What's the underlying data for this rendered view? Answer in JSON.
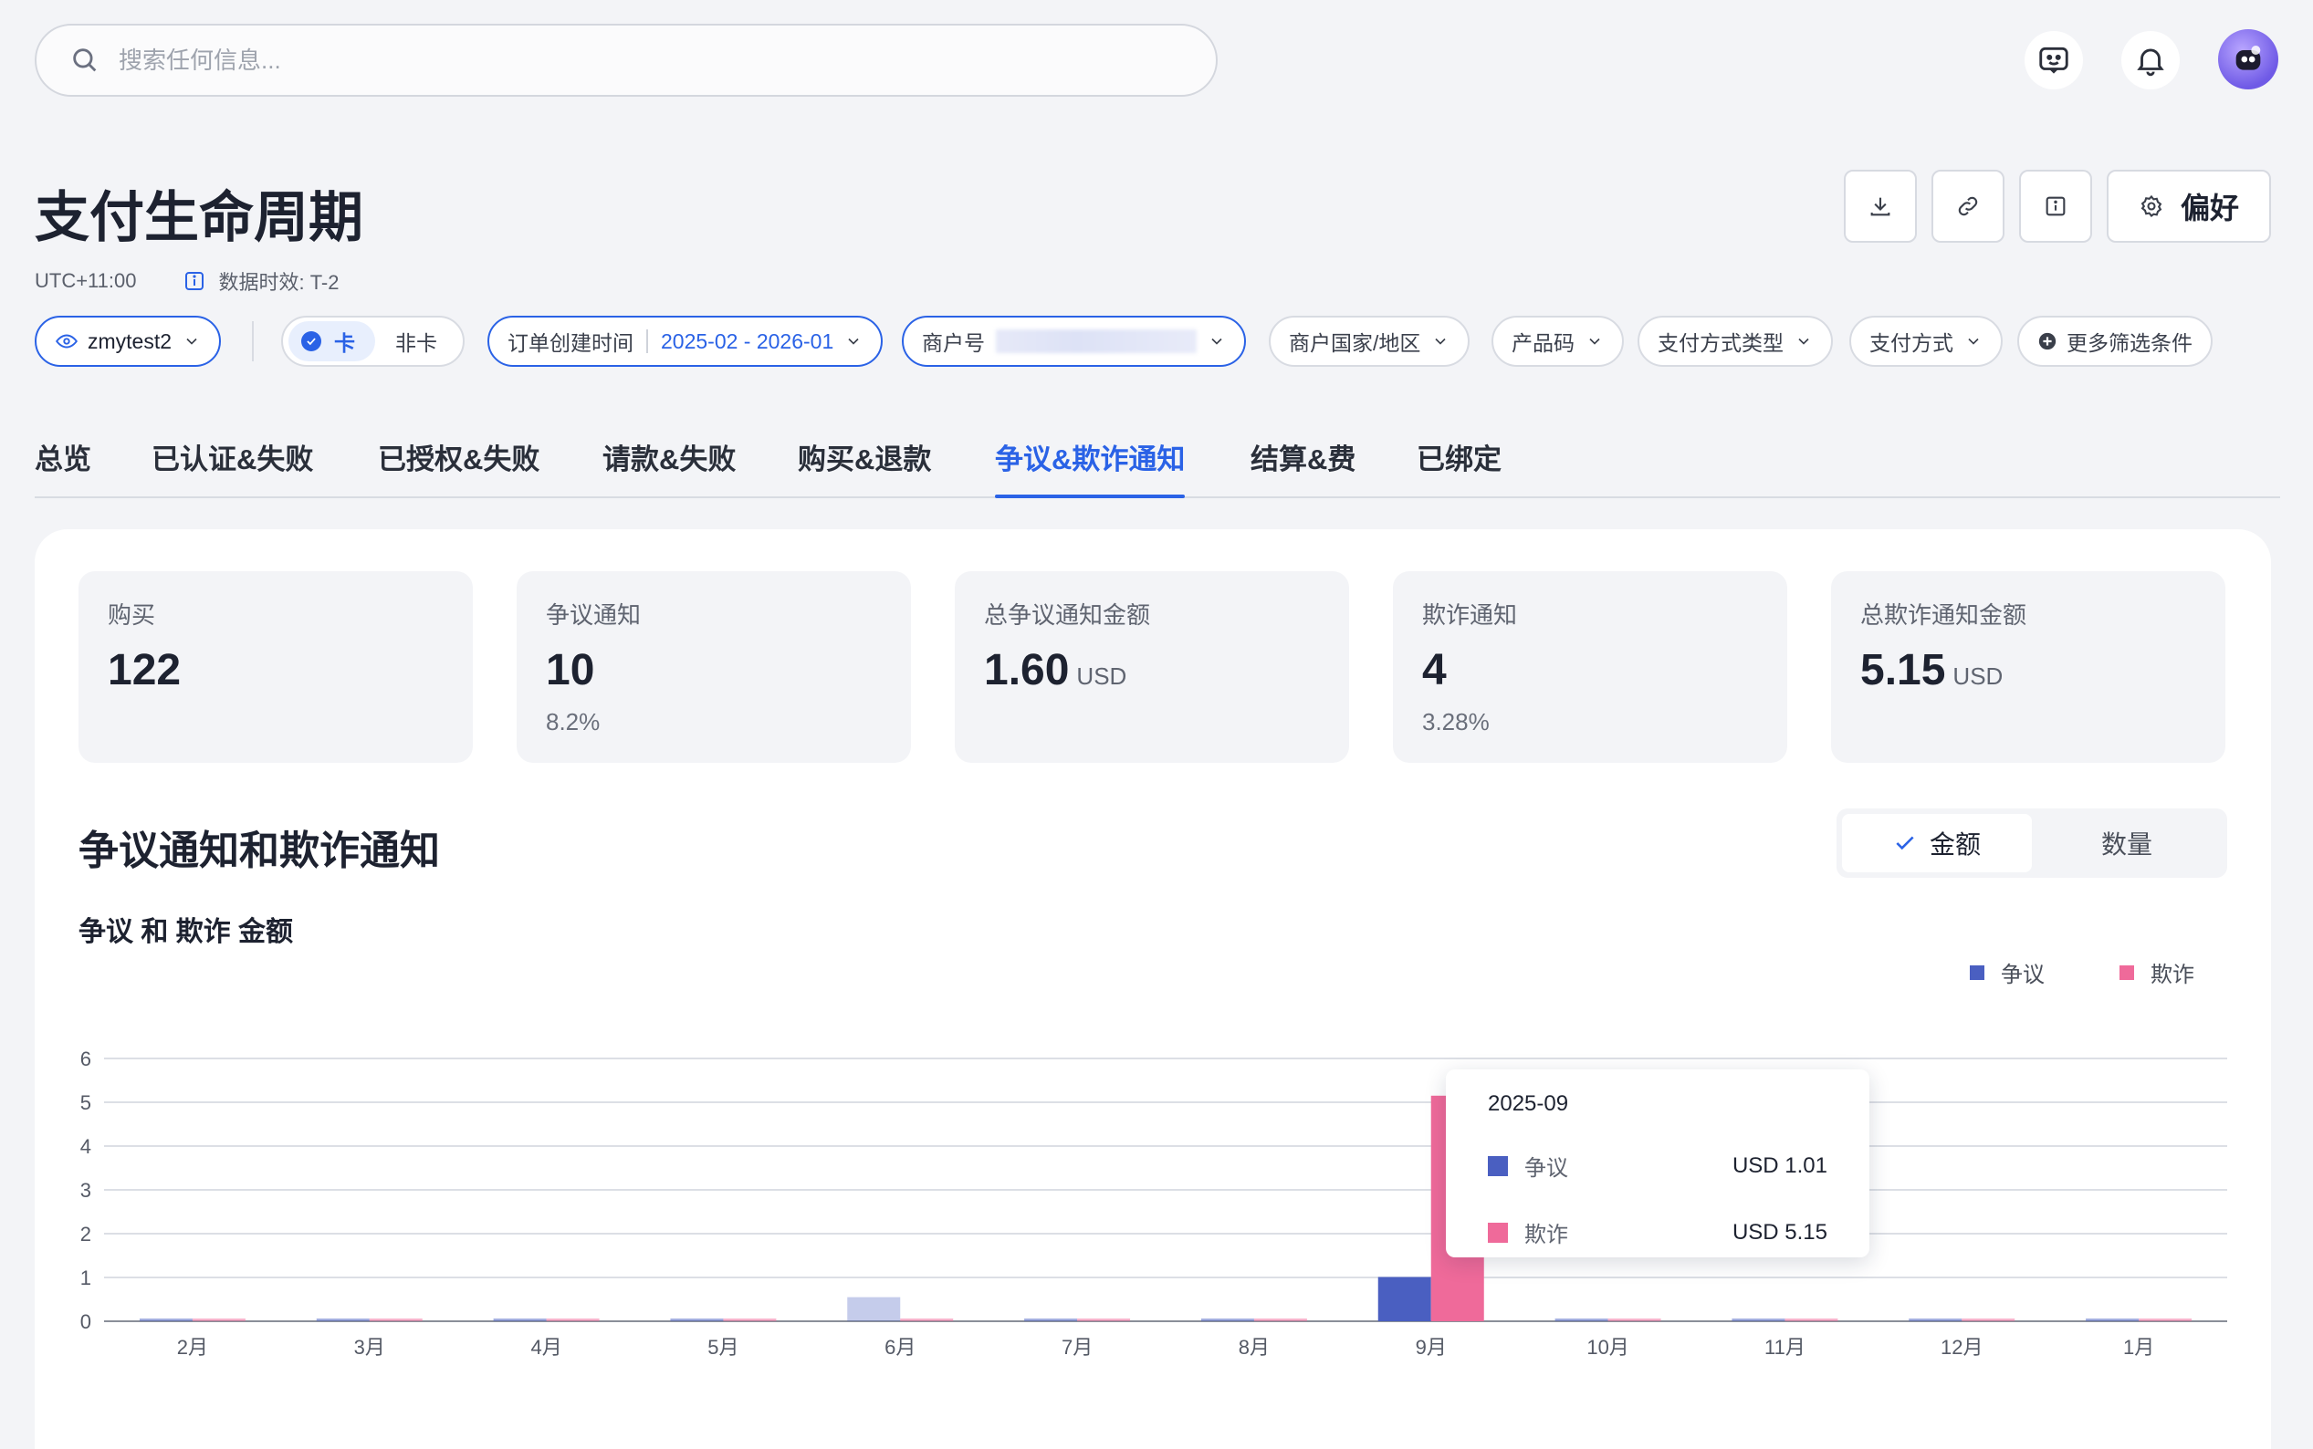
{
  "search": {
    "placeholder": "搜索任何信息..."
  },
  "page": {
    "title": "支付生命周期",
    "timezone": "UTC+11:00",
    "data_freshness": "数据时效: T-2",
    "pref_label": "偏好"
  },
  "filters": {
    "merchant_account": "zmytest2",
    "card": "卡",
    "non_card": "非卡",
    "order_time_label": "订单创建时间",
    "order_time_value": "2025-02 - 2026-01",
    "merchant_id_label": "商户号",
    "merchant_region": "商户国家/地区",
    "product_code": "产品码",
    "payment_method_type": "支付方式类型",
    "payment_method": "支付方式",
    "more_filters": "更多筛选条件"
  },
  "tabs": [
    "总览",
    "已认证&失败",
    "已授权&失败",
    "请款&失败",
    "购买&退款",
    "争议&欺诈通知",
    "结算&费",
    "已绑定"
  ],
  "kpis": [
    {
      "label": "购买",
      "value": "122",
      "unit": "",
      "sub": ""
    },
    {
      "label": "争议通知",
      "value": "10",
      "unit": "",
      "sub": "8.2%"
    },
    {
      "label": "总争议通知金额",
      "value": "1.60",
      "unit": "USD",
      "sub": ""
    },
    {
      "label": "欺诈通知",
      "value": "4",
      "unit": "",
      "sub": "3.28%"
    },
    {
      "label": "总欺诈通知金额",
      "value": "5.15",
      "unit": "USD",
      "sub": ""
    }
  ],
  "section": {
    "title": "争议通知和欺诈通知",
    "chart_title": "争议 和 欺诈 金额",
    "toggle_amount": "金额",
    "toggle_count": "数量"
  },
  "colors": {
    "dispute": "#4a5fc1",
    "fraud": "#ef6a9a",
    "accent": "#2a62e6"
  },
  "chart_data": {
    "type": "bar",
    "title": "争议 和 欺诈 金额",
    "categories": [
      "2月",
      "3月",
      "4月",
      "5月",
      "6月",
      "7月",
      "8月",
      "9月",
      "10月",
      "11月",
      "12月",
      "1月"
    ],
    "series": [
      {
        "name": "争议",
        "values": [
          0,
          0,
          0,
          0,
          0.55,
          0,
          0,
          1.01,
          0,
          0,
          0,
          0
        ]
      },
      {
        "name": "欺诈",
        "values": [
          0,
          0,
          0,
          0,
          0,
          0,
          0,
          5.15,
          0,
          0,
          0,
          0
        ]
      }
    ],
    "y_ticks": [
      "0",
      "1",
      "2",
      "3",
      "4",
      "5",
      "6"
    ],
    "ylim": [
      0,
      6
    ],
    "grid": true,
    "legend": "top-right",
    "highlight_index": 7
  },
  "tooltip": {
    "title": "2025-09",
    "rows": [
      {
        "name": "争议",
        "value": "USD 1.01"
      },
      {
        "name": "欺诈",
        "value": "USD 5.15"
      }
    ]
  }
}
